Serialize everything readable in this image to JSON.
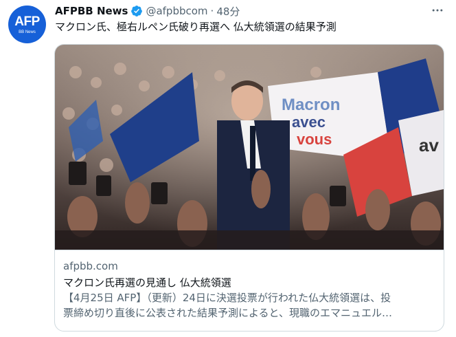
{
  "account": {
    "avatar_logo": "AFP",
    "avatar_sub": "BB News",
    "name": "AFPBB News",
    "handle": "@afpbbcom",
    "separator": "·",
    "time": "48分"
  },
  "icons": {
    "verified": "verified-badge-icon",
    "more": "more-options-icon"
  },
  "colors": {
    "avatar_bg": "#1660d8",
    "verified": "#1d9bf0",
    "secondary_text": "#536471",
    "border": "#cfd9de"
  },
  "tweet": {
    "text": "マクロン氏、極右ルペン氏破り再選へ 仏大統領選の結果予測"
  },
  "card": {
    "image_sign_line1": "Macron",
    "image_sign_line2": "avec",
    "image_sign_line3": "vous",
    "image_sign_right": "av",
    "domain": "afpbb.com",
    "title": "マクロン氏再選の見通し 仏大統領選",
    "description_line1": "【4月25日 AFP】（更新）24日に決選投票が行われた仏大統領選は、投",
    "description_line2": "票締め切り直後に公表された結果予測によると、現職のエマニュエル…"
  }
}
